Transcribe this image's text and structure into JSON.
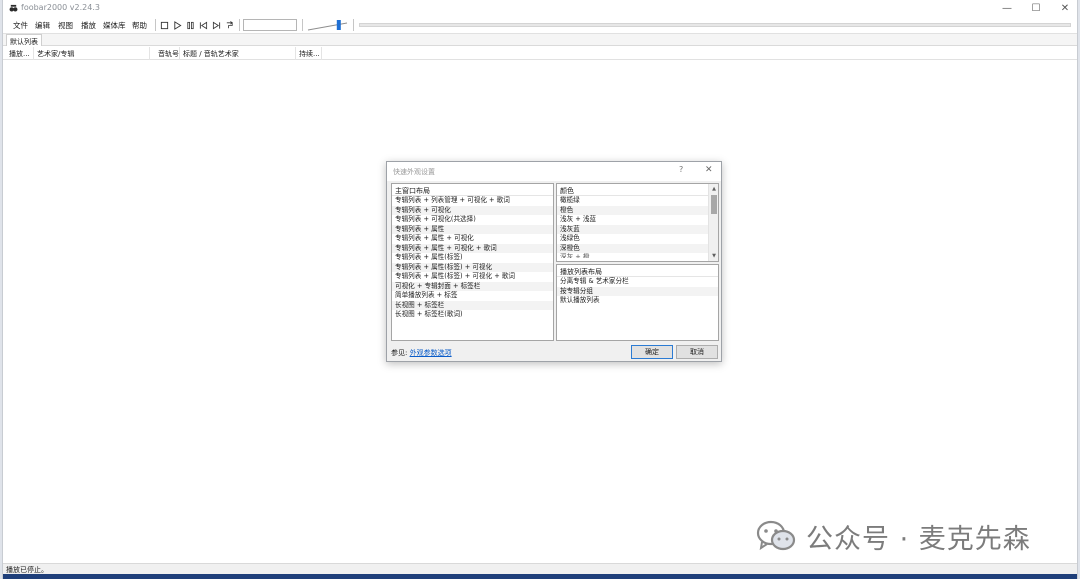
{
  "window": {
    "title": "foobar2000 v2.24.3",
    "controls": {
      "minimize": "—",
      "maximize": "☐",
      "close": "✕"
    }
  },
  "menu": [
    "文件",
    "编辑",
    "视图",
    "播放",
    "媒体库",
    "帮助"
  ],
  "toolbar": {
    "icons": [
      "stop-icon",
      "play-icon",
      "pause-icon",
      "previous-icon",
      "next-icon",
      "random-icon"
    ],
    "volume_level": 0.8
  },
  "playlist": {
    "tab_label": "默认列表",
    "columns": [
      "播放...",
      "艺术家/专辑",
      "音轨号",
      "标题 / 音轨艺术家",
      "持续..."
    ]
  },
  "status": {
    "text": "播放已停止。"
  },
  "watermark": {
    "text": "公众号 · 麦克先森"
  },
  "dialog": {
    "title": "快速外观设置",
    "help": "?",
    "close": "✕",
    "layout_header": "主窗口布局",
    "layout_items": [
      "专辑列表 + 列表管理 + 可视化 + 歌词",
      "专辑列表 + 可视化",
      "专辑列表 + 可视化(共选择)",
      "专辑列表 + 属性",
      "专辑列表 + 属性 + 可视化",
      "专辑列表 + 属性 + 可视化 + 歌词",
      "专辑列表 + 属性(标签)",
      "专辑列表 + 属性(标签) + 可视化",
      "专辑列表 + 属性(标签) + 可视化 + 歌词",
      "可视化 + 专辑封面 + 标签栏",
      "简单播放列表 + 标签",
      "长视图 + 标签栏",
      "长视图 + 标签栏(歌词)"
    ],
    "color_header": "颜色",
    "color_items": [
      "橄榄绿",
      "橙色",
      "浅灰 + 浅蓝",
      "浅灰蓝",
      "浅绿色",
      "深橙色",
      "深灰 + 橙"
    ],
    "playlist_layout_header": "播放列表布局",
    "playlist_layout_items": [
      "分离专辑 & 艺术家分栏",
      "按专辑分组",
      "默认播放列表"
    ],
    "see_also_label": "参见: ",
    "see_also_link": "外观参数选项",
    "ok_label": "确定",
    "cancel_label": "取消"
  }
}
